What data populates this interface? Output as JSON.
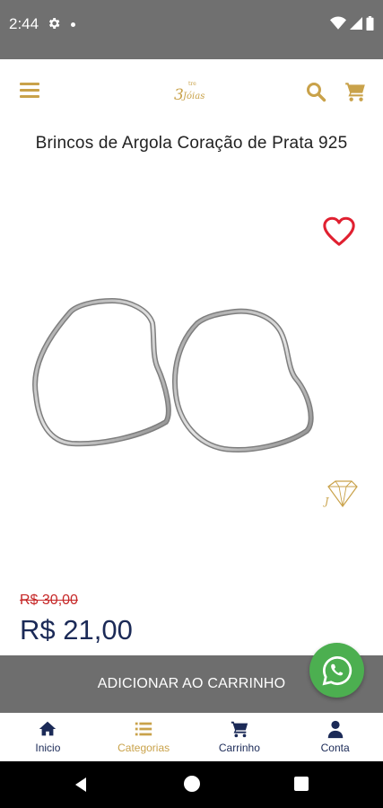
{
  "status_bar": {
    "time": "2:44"
  },
  "header": {
    "logo_alt": "3 Jóias"
  },
  "product": {
    "title": "Brincos de Argola Coração de Prata 925",
    "old_price": "R$ 30,00",
    "price": "R$ 21,00"
  },
  "actions": {
    "add_to_cart_label": "ADICIONAR AO CARRINHO"
  },
  "bottom_nav": {
    "items": [
      {
        "label": "Inicio",
        "icon": "home-icon"
      },
      {
        "label": "Categorias",
        "icon": "list-icon"
      },
      {
        "label": "Carrinho",
        "icon": "cart-icon"
      },
      {
        "label": "Conta",
        "icon": "user-icon"
      }
    ],
    "active": "Categorias"
  },
  "colors": {
    "accent_gold": "#c9a24a",
    "navy": "#1b2a57",
    "sale_red": "#c62828",
    "bar_gray": "#6e6e6e",
    "whatsapp_green": "#4caf50"
  }
}
